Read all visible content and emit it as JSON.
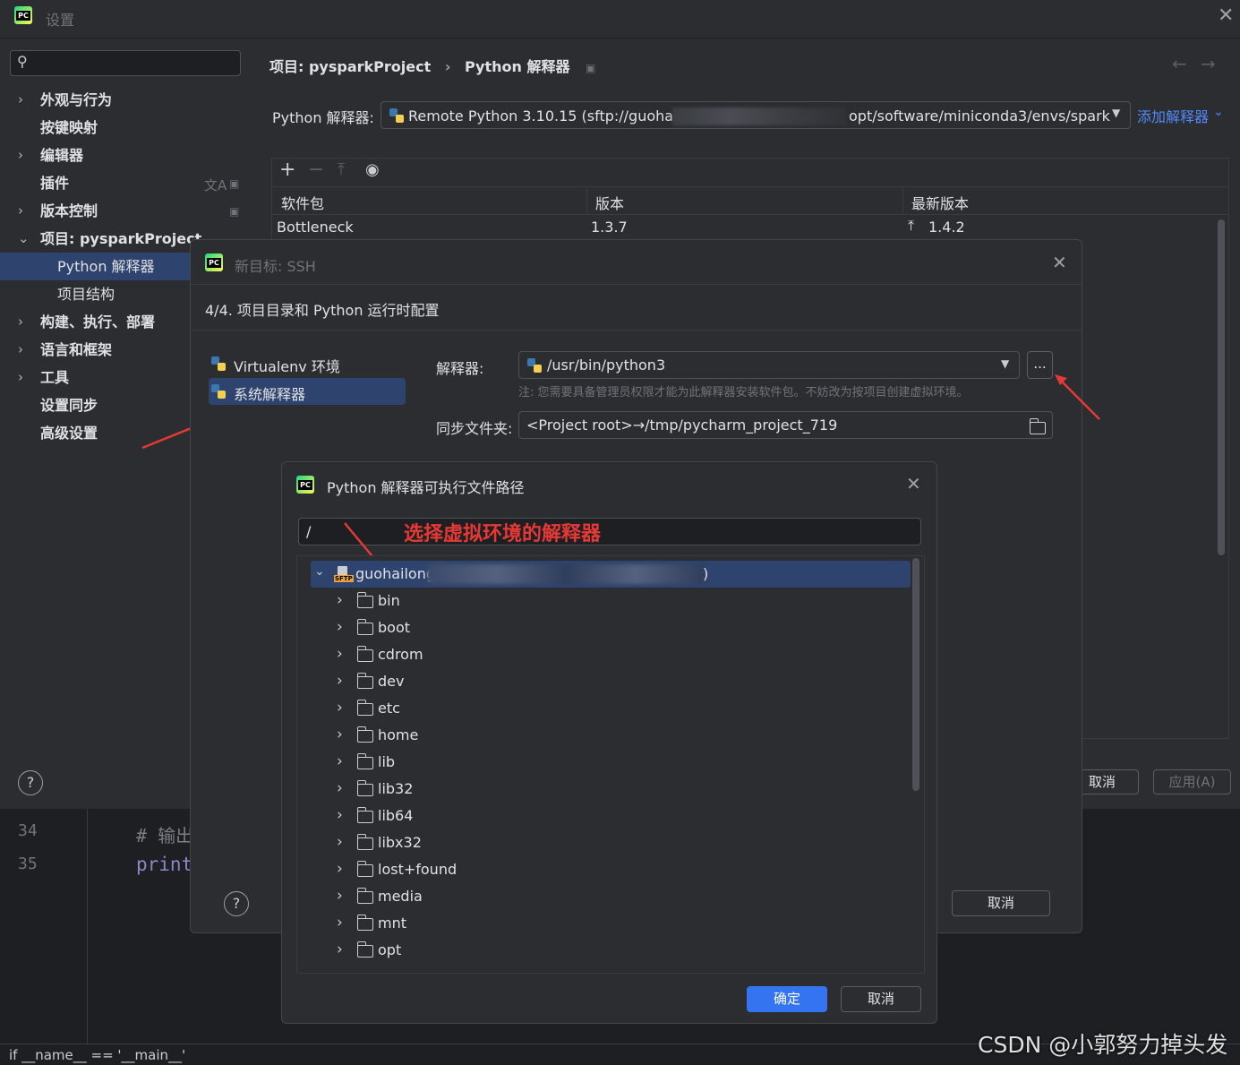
{
  "settings": {
    "title": "设置",
    "breadcrumb_project": "项目: pysparkProject",
    "breadcrumb_page": "Python 解释器",
    "interpreter_label": "Python 解释器:",
    "interpreter_value_left": "Remote Python 3.10.15 (sftp://guohail",
    "interpreter_value_right": "opt/software/miniconda3/envs/spark",
    "add_interpreter": "添加解释器",
    "columns": [
      "软件包",
      "版本",
      "最新版本"
    ],
    "packages": [
      {
        "name": "Bottleneck",
        "version": "1.3.7",
        "latest": "1.4.2"
      }
    ],
    "cancel": "取消",
    "apply": "应用(A)",
    "sidebar": [
      {
        "label": "外观与行为",
        "chevron": "›",
        "indent": 0
      },
      {
        "label": "按键映射",
        "chevron": "",
        "indent": 0
      },
      {
        "label": "编辑器",
        "chevron": "›",
        "indent": 0
      },
      {
        "label": "插件",
        "chevron": "",
        "indent": 0
      },
      {
        "label": "版本控制",
        "chevron": "›",
        "indent": 0
      },
      {
        "label": "项目: pysparkProject",
        "chevron": "⌄",
        "indent": 0
      },
      {
        "label": "Python 解释器",
        "chevron": "",
        "indent": 1,
        "selected": true
      },
      {
        "label": "项目结构",
        "chevron": "",
        "indent": 1
      },
      {
        "label": "构建、执行、部署",
        "chevron": "›",
        "indent": 0
      },
      {
        "label": "语言和框架",
        "chevron": "›",
        "indent": 0
      },
      {
        "label": "工具",
        "chevron": "›",
        "indent": 0
      },
      {
        "label": "设置同步",
        "chevron": "",
        "indent": 0
      },
      {
        "label": "高级设置",
        "chevron": "",
        "indent": 0
      }
    ]
  },
  "editor": {
    "lines": [
      {
        "num": "34",
        "code": "# 输出"
      },
      {
        "num": "35",
        "code": "print"
      }
    ],
    "status": "if __name__ == '__main__'"
  },
  "ssh": {
    "title": "新目标: SSH",
    "step": "4/4. 项目目录和 Python 运行时配置",
    "env_types": [
      {
        "label": "Virtualenv 环境"
      },
      {
        "label": "系统解释器"
      }
    ],
    "interpreter_label": "解释器:",
    "interpreter_value": "/usr/bin/python3",
    "browse": "...",
    "note": "注: 您需要具备管理员权限才能为此解释器安装软件包。不妨改为按项目创建虚拟环境。",
    "sync_label": "同步文件夹:",
    "sync_value": "<Project root>→/tmp/pycharm_project_719",
    "cancel": "取消"
  },
  "picker": {
    "title": "Python 解释器可执行文件路径",
    "path": "/",
    "annotation": "选择虚拟环境的解释器",
    "root": "guohailong",
    "root_suffix": ")",
    "folders": [
      "bin",
      "boot",
      "cdrom",
      "dev",
      "etc",
      "home",
      "lib",
      "lib32",
      "lib64",
      "libx32",
      "lost+found",
      "media",
      "mnt",
      "opt"
    ],
    "ok": "确定",
    "cancel": "取消"
  },
  "watermark": "CSDN @小郭努力掉头发"
}
